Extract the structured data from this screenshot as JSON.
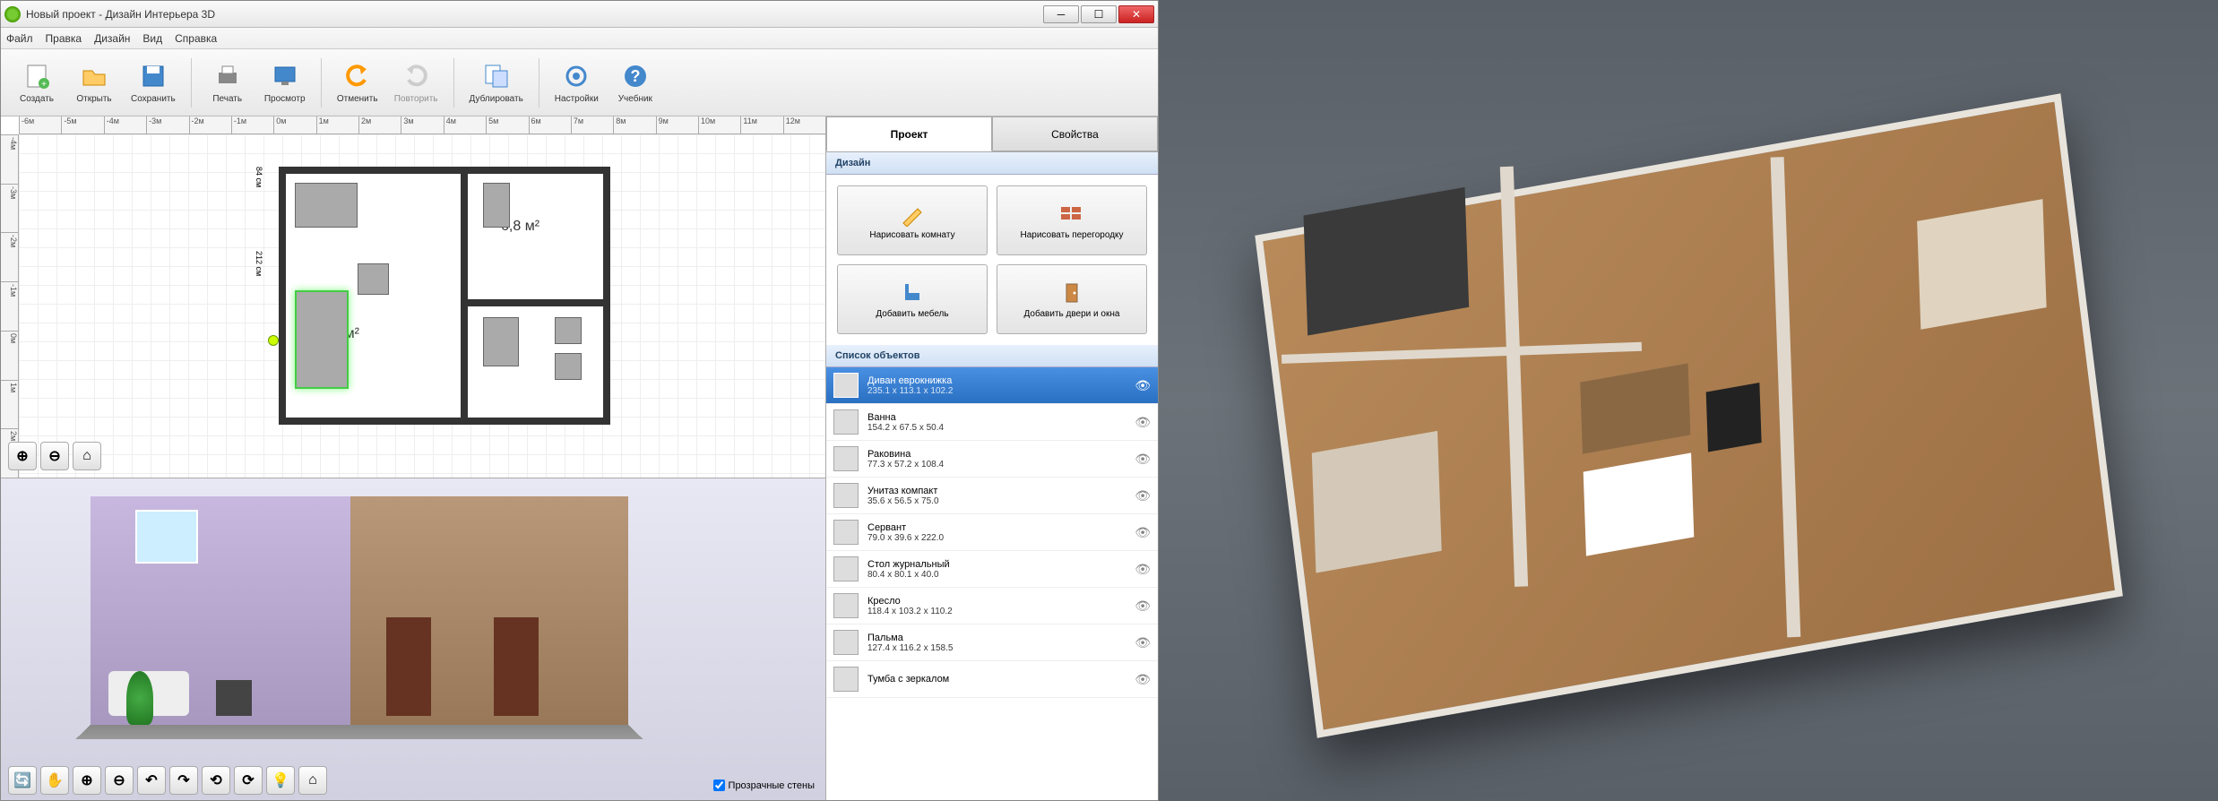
{
  "window": {
    "title": "Новый проект - Дизайн Интерьера 3D"
  },
  "menubar": {
    "file": "Файл",
    "edit": "Правка",
    "design": "Дизайн",
    "view": "Вид",
    "help": "Справка"
  },
  "toolbar": {
    "create": "Создать",
    "open": "Открыть",
    "save": "Сохранить",
    "print": "Печать",
    "preview": "Просмотр",
    "undo": "Отменить",
    "redo": "Повторить",
    "duplicate": "Дублировать",
    "settings": "Настройки",
    "tutorial": "Учебник"
  },
  "ruler_h": [
    "-6м",
    "-5м",
    "-4м",
    "-3м",
    "-2м",
    "-1м",
    "0м",
    "1м",
    "2м",
    "3м",
    "4м",
    "5м",
    "6м",
    "7м",
    "8м",
    "9м",
    "10м",
    "11м",
    "12м"
  ],
  "ruler_v": [
    "-4м",
    "-3м",
    "-2м",
    "-1м",
    "0м",
    "1м",
    "2м"
  ],
  "plan": {
    "room1_area": "16,3 м²",
    "room2_area": "6,8 м²",
    "dim1": "84 см",
    "dim2": "212 см"
  },
  "transparent_walls": "Прозрачные стены",
  "tabs": {
    "project": "Проект",
    "properties": "Свойства"
  },
  "sections": {
    "design": "Дизайн",
    "objects": "Список объектов"
  },
  "design_buttons": {
    "draw_room": "Нарисовать комнату",
    "draw_wall": "Нарисовать перегородку",
    "add_furniture": "Добавить мебель",
    "add_doors": "Добавить двери и окна"
  },
  "objects": [
    {
      "name": "Диван еврокнижка",
      "dims": "235.1 x 113.1 x 102.2",
      "selected": true
    },
    {
      "name": "Ванна",
      "dims": "154.2 x 67.5 x 50.4",
      "selected": false
    },
    {
      "name": "Раковина",
      "dims": "77.3 x 57.2 x 108.4",
      "selected": false
    },
    {
      "name": "Унитаз компакт",
      "dims": "35.6 x 56.5 x 75.0",
      "selected": false
    },
    {
      "name": "Сервант",
      "dims": "79.0 x 39.6 x 222.0",
      "selected": false
    },
    {
      "name": "Стол журнальный",
      "dims": "80.4 x 80.1 x 40.0",
      "selected": false
    },
    {
      "name": "Кресло",
      "dims": "118.4 x 103.2 x 110.2",
      "selected": false
    },
    {
      "name": "Пальма",
      "dims": "127.4 x 116.2 x 158.5",
      "selected": false
    },
    {
      "name": "Тумба с зеркалом",
      "dims": "",
      "selected": false
    }
  ]
}
